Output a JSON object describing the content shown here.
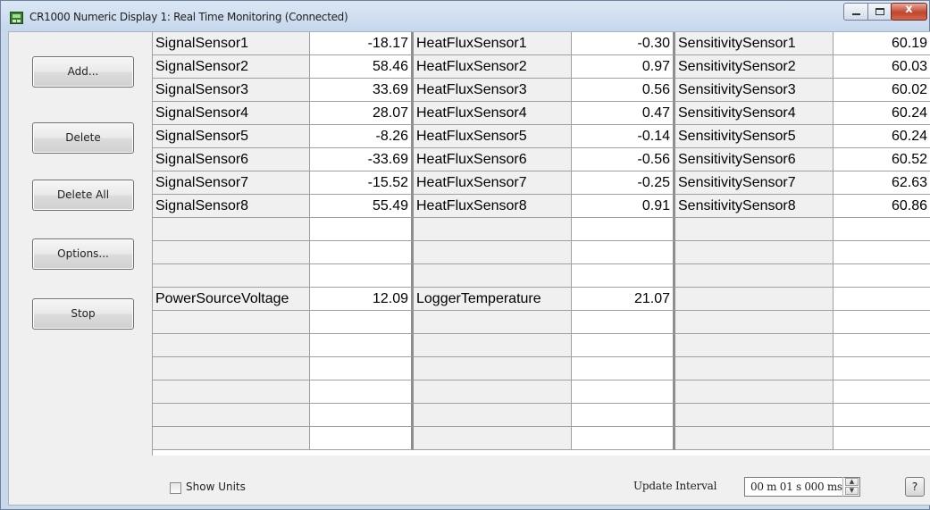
{
  "window": {
    "title": "CR1000 Numeric Display 1: Real Time Monitoring (Connected)",
    "close_glyph": "x"
  },
  "sidebar": {
    "buttons": [
      {
        "label": "Add..."
      },
      {
        "label": "Delete"
      },
      {
        "label": "Delete All"
      },
      {
        "label": "Options..."
      },
      {
        "label": "Stop"
      }
    ]
  },
  "grid": {
    "rows": [
      [
        "SignalSensor1",
        "-18.17",
        "HeatFluxSensor1",
        "-0.30",
        "SensitivitySensor1",
        "60.19"
      ],
      [
        "SignalSensor2",
        "58.46",
        "HeatFluxSensor2",
        "0.97",
        "SensitivitySensor2",
        "60.03"
      ],
      [
        "SignalSensor3",
        "33.69",
        "HeatFluxSensor3",
        "0.56",
        "SensitivitySensor3",
        "60.02"
      ],
      [
        "SignalSensor4",
        "28.07",
        "HeatFluxSensor4",
        "0.47",
        "SensitivitySensor4",
        "60.24"
      ],
      [
        "SignalSensor5",
        "-8.26",
        "HeatFluxSensor5",
        "-0.14",
        "SensitivitySensor5",
        "60.24"
      ],
      [
        "SignalSensor6",
        "-33.69",
        "HeatFluxSensor6",
        "-0.56",
        "SensitivitySensor6",
        "60.52"
      ],
      [
        "SignalSensor7",
        "-15.52",
        "HeatFluxSensor7",
        "-0.25",
        "SensitivitySensor7",
        "62.63"
      ],
      [
        "SignalSensor8",
        "55.49",
        "HeatFluxSensor8",
        "0.91",
        "SensitivitySensor8",
        "60.86"
      ],
      [
        "",
        "",
        "",
        "",
        "",
        ""
      ],
      [
        "",
        "",
        "",
        "",
        "",
        ""
      ],
      [
        "",
        "",
        "",
        "",
        "",
        ""
      ],
      [
        "PowerSourceVoltage",
        "12.09",
        "LoggerTemperature",
        "21.07",
        "",
        ""
      ],
      [
        "",
        "",
        "",
        "",
        "",
        ""
      ],
      [
        "",
        "",
        "",
        "",
        "",
        ""
      ],
      [
        "",
        "",
        "",
        "",
        "",
        ""
      ],
      [
        "",
        "",
        "",
        "",
        "",
        ""
      ],
      [
        "",
        "",
        "",
        "",
        "",
        ""
      ],
      [
        "",
        "",
        "",
        "",
        "",
        ""
      ]
    ]
  },
  "bottom": {
    "show_units_label": "Show Units",
    "show_units_checked": false,
    "update_interval_label": "Update Interval",
    "update_interval_value": "00 m 01 s 000 ms",
    "help_label": "?",
    "spin_up": "▲",
    "spin_down": "▼"
  }
}
